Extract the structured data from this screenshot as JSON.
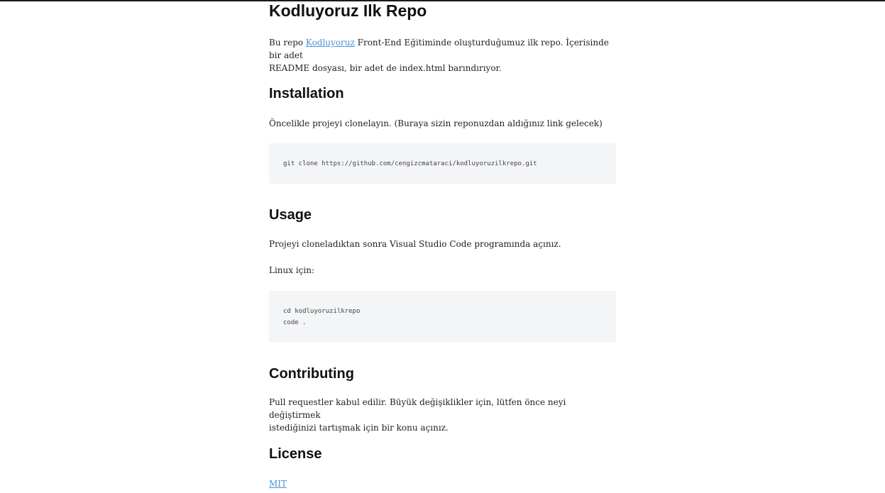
{
  "readme": {
    "title": "Kodluyoruz Ilk Repo",
    "intro": {
      "prefix": "Bu repo ",
      "link_text": "Kodluyoruz",
      "suffix_line1": " Front-End Eğitiminde oluşturduğumuz ilk repo. İçerisinde bir adet",
      "line2": "README dosyası, bir adet de index.html barındırıyor."
    },
    "installation": {
      "heading": "Installation",
      "text": "Öncelikle projeyi clonelayın. (Buraya sizin reponuzdan aldığınız link gelecek)",
      "code": "git clone https://github.com/cengizcmataraci/kodluyoruzilkrepo.git"
    },
    "usage": {
      "heading": "Usage",
      "text": "Projeyi cloneladıktan sonra Visual Studio Code programında açınız.",
      "linux_label": "Linux için:",
      "code_line1": "cd kodluyoruzilkrepo",
      "code_line2": "code ."
    },
    "contributing": {
      "heading": "Contributing",
      "line1": "Pull requestler kabul edilir. Büyük değişiklikler için, lütfen önce neyi değiştirmek",
      "line2": "istediğinizi tartışmak için bir konu açınız."
    },
    "license": {
      "heading": "License",
      "link_text": "MIT"
    }
  }
}
